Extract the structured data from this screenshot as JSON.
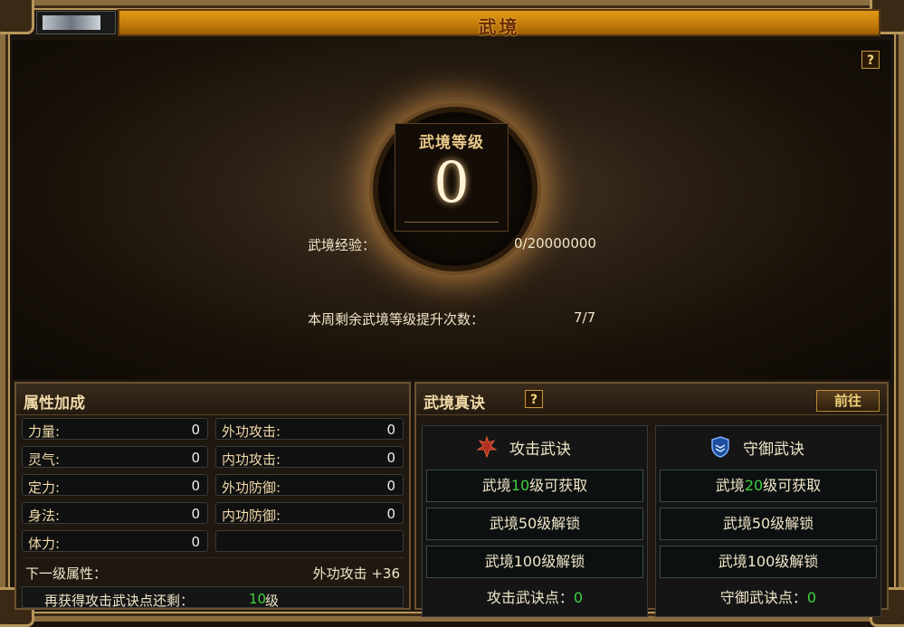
{
  "window": {
    "title": "武境"
  },
  "level": {
    "label": "武境等级",
    "value": "0"
  },
  "exp": {
    "label": "武境经验：",
    "value": "0/20000000"
  },
  "weekly": {
    "label": "本周剩余武境等级提升次数：",
    "value": "7/7"
  },
  "attributes": {
    "title": "属性加成",
    "left": [
      {
        "label": "力量:",
        "value": "0"
      },
      {
        "label": "灵气:",
        "value": "0"
      },
      {
        "label": "定力:",
        "value": "0"
      },
      {
        "label": "身法:",
        "value": "0"
      },
      {
        "label": "体力:",
        "value": "0"
      }
    ],
    "right": [
      {
        "label": "外功攻击:",
        "value": "0"
      },
      {
        "label": "内功攻击:",
        "value": "0"
      },
      {
        "label": "外功防御:",
        "value": "0"
      },
      {
        "label": "内功防御:",
        "value": "0"
      }
    ],
    "next_label": "下一级属性：",
    "next_value": "外功攻击 +36",
    "bottom_prefix": "再获得攻击武诀点还剩：",
    "bottom_value": "10",
    "bottom_suffix": "级"
  },
  "secrets": {
    "title": "武境真诀",
    "goto_label": "前往",
    "attack": {
      "title": "攻击武诀",
      "items": [
        {
          "prefix": "武境",
          "level": "10",
          "suffix": "级可获取",
          "highlight": true
        },
        {
          "text": "武境50级解锁"
        },
        {
          "text": "武境100级解锁"
        }
      ],
      "points_label": "攻击武诀点：",
      "points_value": "0"
    },
    "defense": {
      "title": "守御武诀",
      "items": [
        {
          "prefix": "武境",
          "level": "20",
          "suffix": "级可获取",
          "highlight": true
        },
        {
          "text": "武境50级解锁"
        },
        {
          "text": "武境100级解锁"
        }
      ],
      "points_label": "守御武诀点：",
      "points_value": "0"
    }
  },
  "help_icon": "?",
  "colors": {
    "accent": "#c27a09",
    "green": "#3fd13f",
    "gold": "#f0d9a8"
  }
}
